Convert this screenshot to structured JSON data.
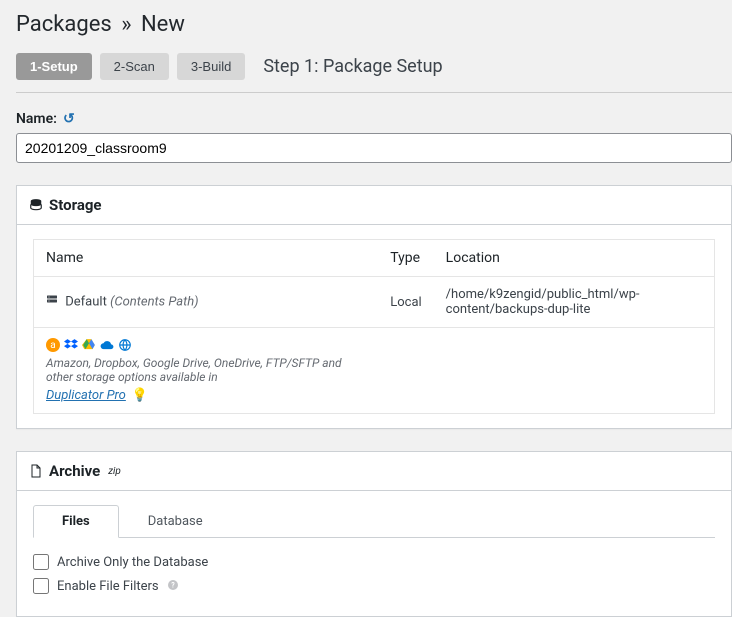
{
  "page": {
    "title_root": "Packages",
    "title_leaf": "New",
    "separator": "»"
  },
  "wizard": {
    "steps": [
      "1-Setup",
      "2-Scan",
      "3-Build"
    ],
    "active_index": 0,
    "heading": "Step 1: Package Setup"
  },
  "name": {
    "label": "Name:",
    "value": "20201209_classroom9"
  },
  "storage": {
    "title": "Storage",
    "columns": [
      "Name",
      "Type",
      "Location"
    ],
    "rows": [
      {
        "name": "Default",
        "name_suffix": "(Contents Path)",
        "type": "Local",
        "location": "/home/k9zengid/public_html/wp-content/backups-dup-lite"
      }
    ],
    "promo_text": "Amazon, Dropbox, Google Drive, OneDrive, FTP/SFTP and other storage options available in ",
    "promo_link": "Duplicator Pro"
  },
  "archive": {
    "title": "Archive",
    "format": "zip",
    "tabs": [
      "Files",
      "Database"
    ],
    "active_tab": 0,
    "options": [
      {
        "label": "Archive Only the Database",
        "checked": false,
        "help": false
      },
      {
        "label": "Enable File Filters",
        "checked": false,
        "help": true
      }
    ]
  }
}
